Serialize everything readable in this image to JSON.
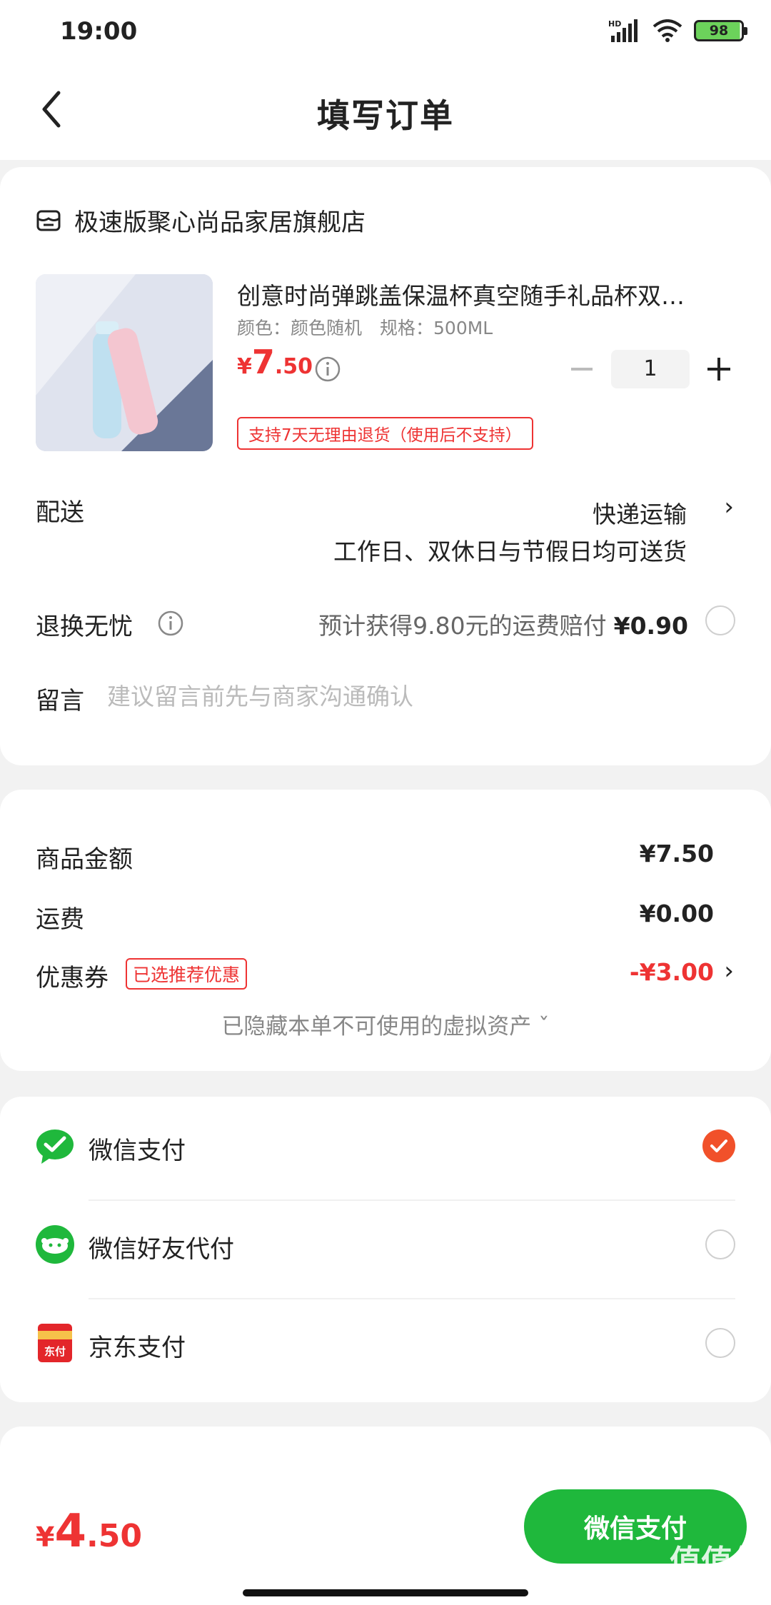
{
  "status_bar": {
    "time": "19:00",
    "battery": "98",
    "network": "HD"
  },
  "nav": {
    "title": "填写订单"
  },
  "store": {
    "name": "极速版聚心尚品家居旗舰店"
  },
  "product": {
    "title": "创意时尚弹跳盖保温杯真空随手礼品杯双…",
    "spec": "颜色：颜色随机　规格：500ML",
    "price_symbol": "¥",
    "price_int": "7",
    "price_dec": ".50",
    "quantity": "1",
    "return_tag": "支持7天无理由退货（使用后不支持）"
  },
  "delivery": {
    "label": "配送",
    "method": "快递运输",
    "note": "工作日、双休日与节假日均可送货"
  },
  "return_insurance": {
    "label": "退换无忧",
    "text": "预计获得9.80元的运费赔付",
    "price": "¥0.90"
  },
  "message": {
    "label": "留言",
    "placeholder": "建议留言前先与商家沟通确认"
  },
  "summary": {
    "goods_label": "商品金额",
    "goods_value": "¥7.50",
    "shipping_label": "运费",
    "shipping_value": "¥0.00",
    "coupon_label": "优惠券",
    "coupon_tag": "已选推荐优惠",
    "coupon_value": "-¥3.00",
    "hidden_assets": "已隐藏本单不可使用的虚拟资产 ˇ"
  },
  "payment": {
    "options": [
      {
        "label": "微信支付",
        "selected": true
      },
      {
        "label": "微信好友代付",
        "selected": false
      },
      {
        "label": "京东支付",
        "selected": false
      }
    ],
    "jd_icon_text": "东付"
  },
  "bottom": {
    "total_symbol": "¥",
    "total_int": "4",
    "total_dec": ".50",
    "pay_button": "微信支付",
    "watermark": "值值值",
    "watermark_url": "zhizhizhi.com"
  },
  "colors": {
    "accent_red": "#e33333",
    "wechat_green": "#1fb83c",
    "check_orange": "#f1512a"
  }
}
